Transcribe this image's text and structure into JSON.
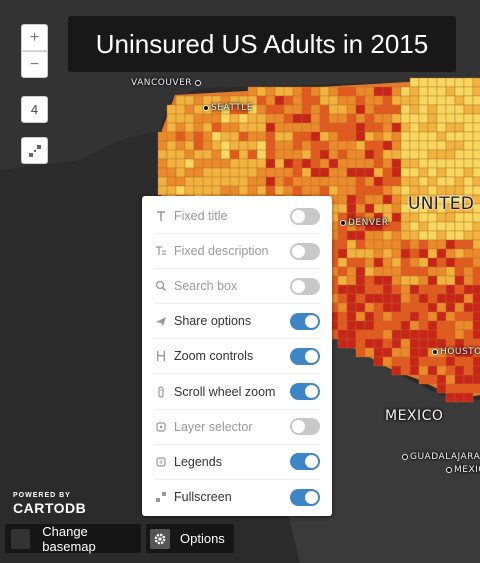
{
  "map": {
    "title": "Uninsured US Adults in 2015",
    "zoom_in": "+",
    "zoom_out": "−",
    "zoom_level": "4",
    "labels": {
      "vancouver": "VANCOUVER",
      "seattle": "SEATTLE",
      "denver": "DENVER",
      "usa": "UNITED STATES OF AMERICA",
      "houston": "HOUSTON",
      "mexico": "MEXICO",
      "guadalajara": "GUADALAJARA",
      "mexico_city": "MEXICO"
    },
    "choropleth_colors": [
      "#f6d860",
      "#f0b33e",
      "#ea8a2b",
      "#e25a20",
      "#c8241a"
    ]
  },
  "attribution": {
    "powered_by": "POWERED BY",
    "brand": "CARTODB"
  },
  "bottom_bar": {
    "change_basemap": "Change basemap",
    "options": "Options"
  },
  "options_panel": {
    "items": [
      {
        "label": "Fixed title",
        "icon": "title-t-icon",
        "enabled": false
      },
      {
        "label": "Fixed description",
        "icon": "description-t-icon",
        "enabled": false
      },
      {
        "label": "Search box",
        "icon": "search-icon",
        "enabled": false
      },
      {
        "label": "Share options",
        "icon": "share-icon",
        "enabled": true
      },
      {
        "label": "Zoom controls",
        "icon": "zoom-controls-icon",
        "enabled": true
      },
      {
        "label": "Scroll wheel zoom",
        "icon": "scroll-wheel-icon",
        "enabled": true
      },
      {
        "label": "Layer selector",
        "icon": "layer-selector-icon",
        "enabled": false
      },
      {
        "label": "Legends",
        "icon": "legends-icon",
        "enabled": true
      },
      {
        "label": "Fullscreen",
        "icon": "fullscreen-icon",
        "enabled": true
      }
    ],
    "toggle_on_color": "#3d86c6",
    "toggle_off_color": "#c8c8c8"
  }
}
